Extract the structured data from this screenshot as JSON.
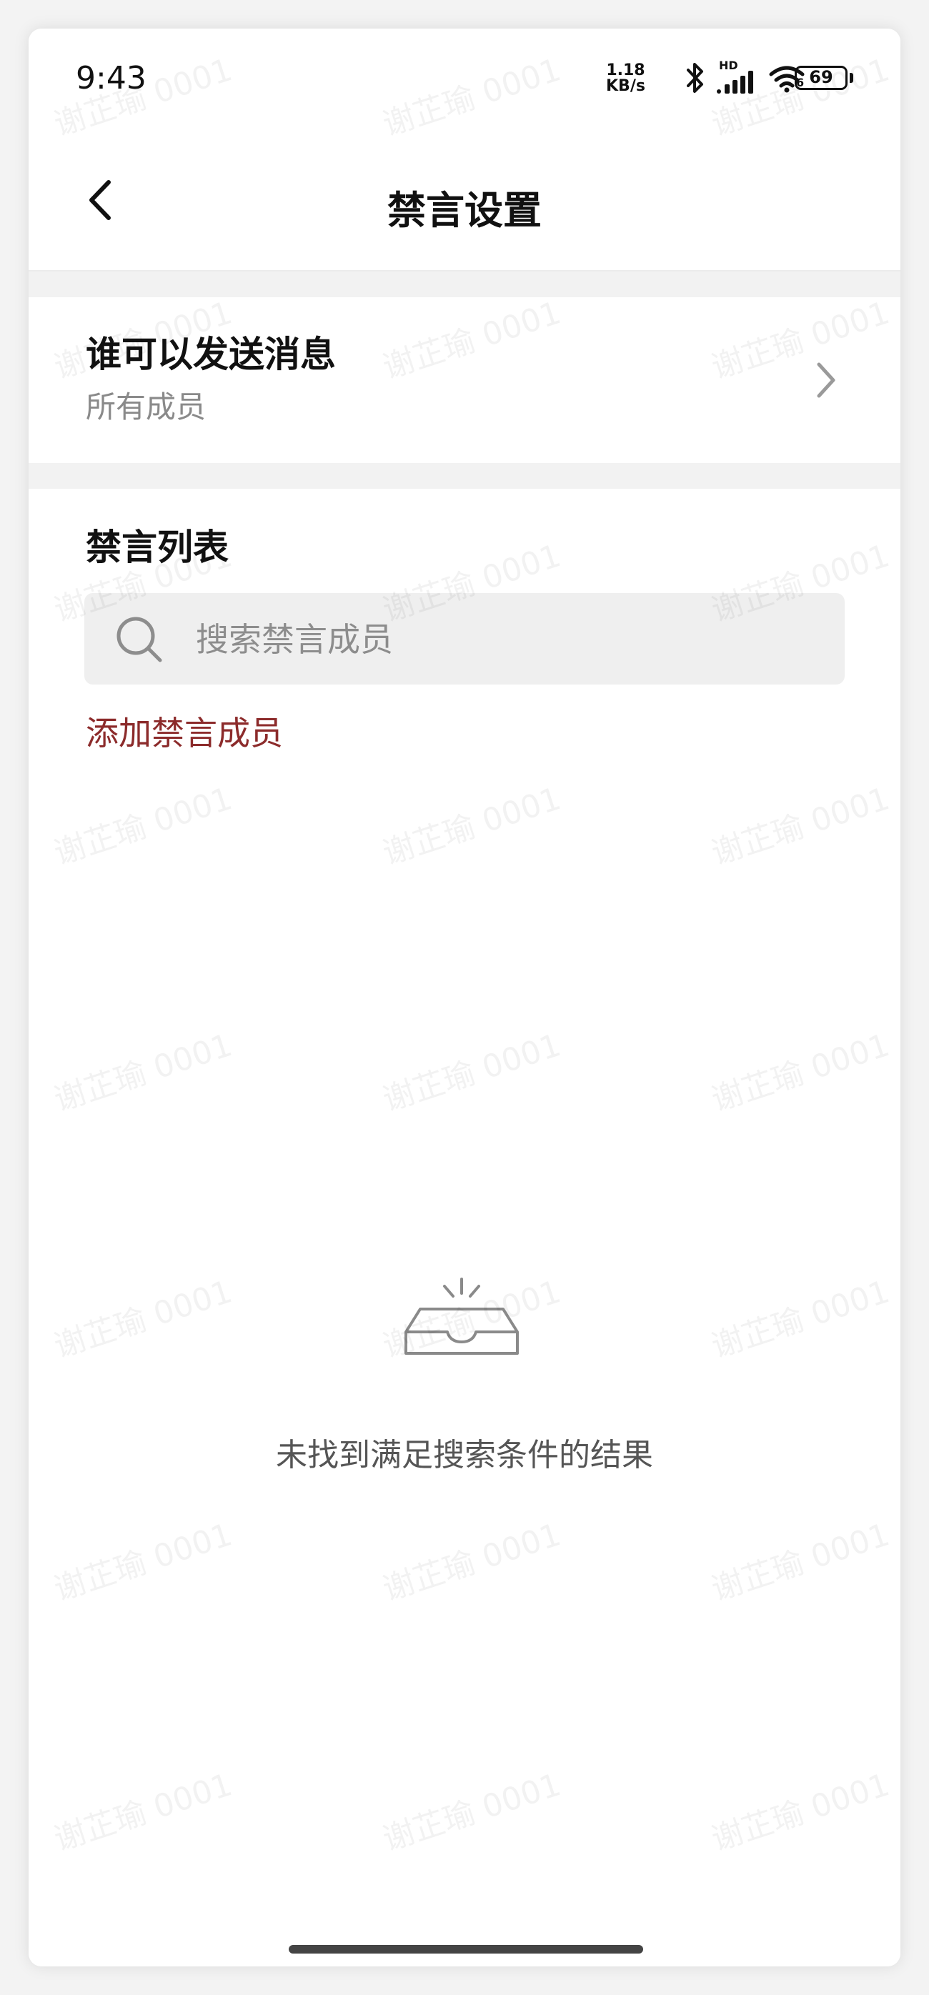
{
  "status_bar": {
    "time": "9:43",
    "net_speed_value": "1.18",
    "net_speed_unit": "KB/s",
    "hd_label": "HD",
    "wifi_label": "6",
    "battery_level": "69"
  },
  "header": {
    "title": "禁言设置"
  },
  "send_permission": {
    "title": "谁可以发送消息",
    "value": "所有成员"
  },
  "mute_list": {
    "title": "禁言列表",
    "search_placeholder": "搜索禁言成员",
    "add_label": "添加禁言成员",
    "empty_text": "未找到满足搜索条件的结果"
  },
  "watermark_text": "谢芷瑜 0001",
  "colors": {
    "accent_link": "#8c2b2b",
    "background": "#ffffff",
    "divider": "#f2f2f2"
  },
  "icons": [
    "back-icon",
    "chevron-right-icon",
    "search-icon",
    "empty-inbox-icon",
    "bluetooth-icon",
    "signal-icon",
    "wifi-icon",
    "battery-icon"
  ]
}
